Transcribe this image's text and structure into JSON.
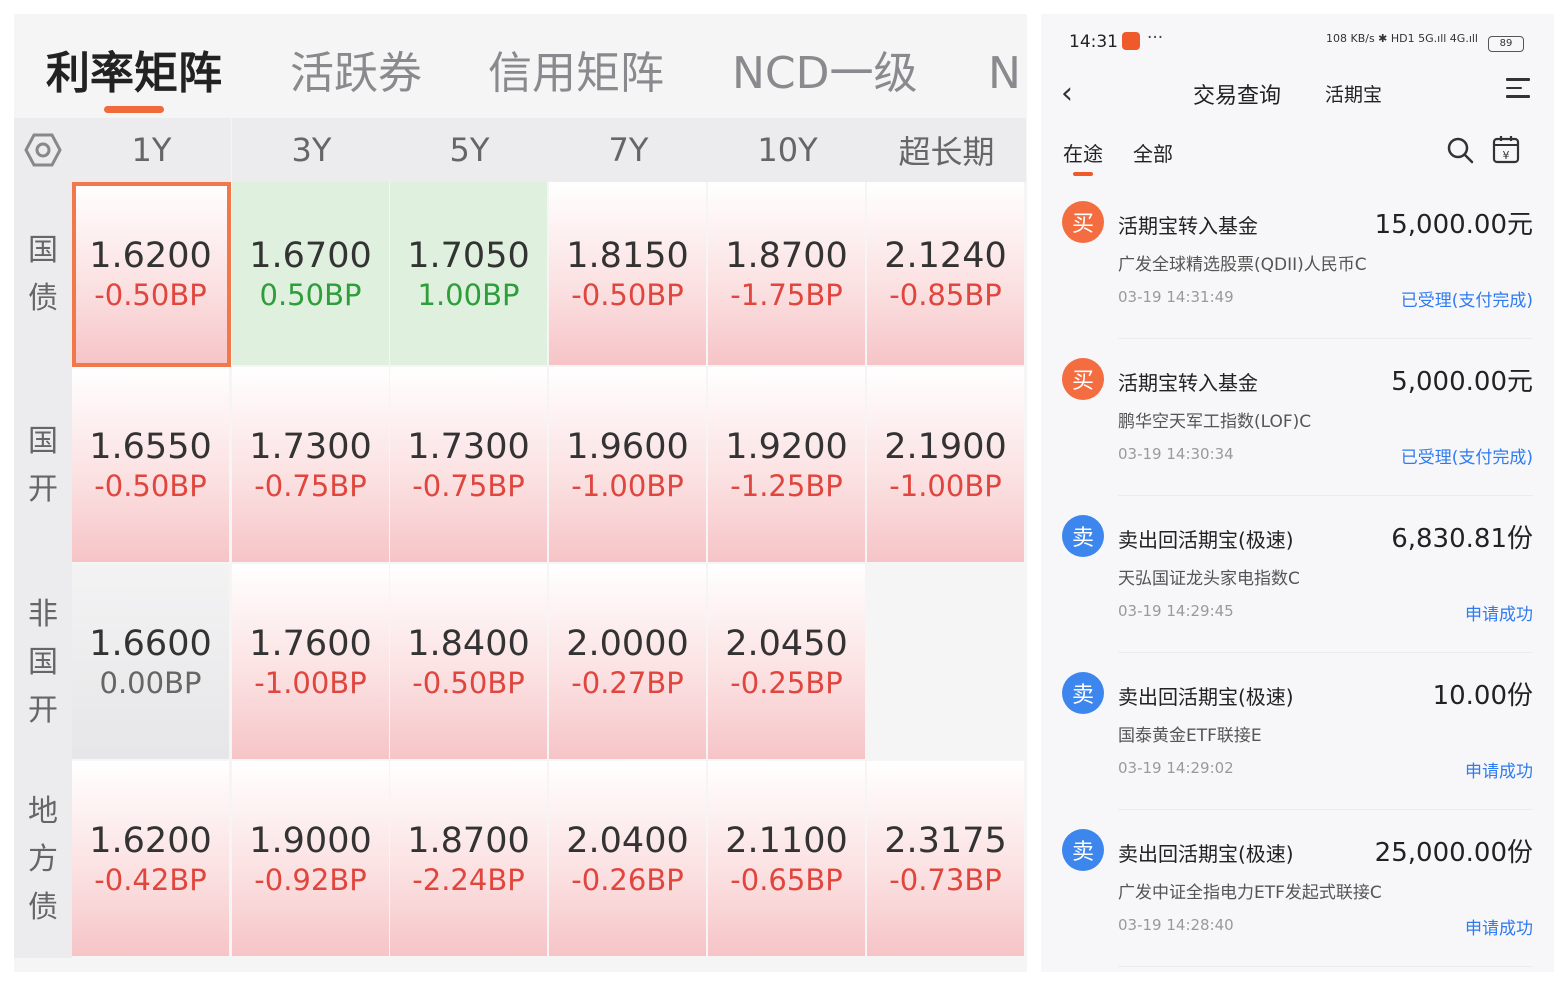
{
  "matrix": {
    "tabs": [
      "利率矩阵",
      "活跃券",
      "信用矩阵",
      "NCD一级",
      "N"
    ],
    "columns": [
      "1Y",
      "3Y",
      "5Y",
      "7Y",
      "10Y",
      "超长期"
    ],
    "rows": [
      {
        "label": [
          "国",
          "债"
        ],
        "cells": [
          {
            "rate": "1.6200",
            "change": "-0.50BP",
            "tone": "red"
          },
          {
            "rate": "1.6700",
            "change": "0.50BP",
            "tone": "green"
          },
          {
            "rate": "1.7050",
            "change": "1.00BP",
            "tone": "green"
          },
          {
            "rate": "1.8150",
            "change": "-0.50BP",
            "tone": "red"
          },
          {
            "rate": "1.8700",
            "change": "-1.75BP",
            "tone": "red"
          },
          {
            "rate": "2.1240",
            "change": "-0.85BP",
            "tone": "red"
          }
        ]
      },
      {
        "label": [
          "国",
          "开"
        ],
        "cells": [
          {
            "rate": "1.6550",
            "change": "-0.50BP",
            "tone": "red"
          },
          {
            "rate": "1.7300",
            "change": "-0.75BP",
            "tone": "red"
          },
          {
            "rate": "1.7300",
            "change": "-0.75BP",
            "tone": "red"
          },
          {
            "rate": "1.9600",
            "change": "-1.00BP",
            "tone": "red"
          },
          {
            "rate": "1.9200",
            "change": "-1.25BP",
            "tone": "red"
          },
          {
            "rate": "2.1900",
            "change": "-1.00BP",
            "tone": "red"
          }
        ]
      },
      {
        "label": [
          "非",
          "国",
          "开"
        ],
        "cells": [
          {
            "rate": "1.6600",
            "change": "0.00BP",
            "tone": "gray"
          },
          {
            "rate": "1.7600",
            "change": "-1.00BP",
            "tone": "red"
          },
          {
            "rate": "1.8400",
            "change": "-0.50BP",
            "tone": "red"
          },
          {
            "rate": "2.0000",
            "change": "-0.27BP",
            "tone": "red"
          },
          {
            "rate": "2.0450",
            "change": "-0.25BP",
            "tone": "red"
          },
          {
            "rate": "",
            "change": "",
            "tone": "empty"
          }
        ]
      },
      {
        "label": [
          "地",
          "方",
          "债"
        ],
        "cells": [
          {
            "rate": "1.6200",
            "change": "-0.42BP",
            "tone": "red"
          },
          {
            "rate": "1.9000",
            "change": "-0.92BP",
            "tone": "red"
          },
          {
            "rate": "1.8700",
            "change": "-2.24BP",
            "tone": "red"
          },
          {
            "rate": "2.0400",
            "change": "-0.26BP",
            "tone": "red"
          },
          {
            "rate": "2.1100",
            "change": "-0.65BP",
            "tone": "red"
          },
          {
            "rate": "2.3175",
            "change": "-0.73BP",
            "tone": "red"
          }
        ]
      }
    ],
    "colors": {
      "up": "#2e9e3b",
      "down": "#e0463e",
      "accent": "#f26a3c"
    }
  },
  "phone": {
    "status": {
      "time": "14:31",
      "dots": "···",
      "signal": "108 KB/s ✱ HD1 5G.ıll 4G.ıll",
      "battery": "89"
    },
    "nav": {
      "back": "‹",
      "title": "交易查询",
      "subtitle": "活期宝"
    },
    "filters": [
      "在途",
      "全部"
    ],
    "transactions": [
      {
        "type": "买",
        "kind": "buy",
        "title": "活期宝转入基金",
        "amount": "15,000.00元",
        "fund": "广发全球精选股票(QDII)人民币C",
        "time": "03-19 14:31:49",
        "status": "已受理(支付完成)"
      },
      {
        "type": "买",
        "kind": "buy",
        "title": "活期宝转入基金",
        "amount": "5,000.00元",
        "fund": "鹏华空天军工指数(LOF)C",
        "time": "03-19 14:30:34",
        "status": "已受理(支付完成)"
      },
      {
        "type": "卖",
        "kind": "sell",
        "title": "卖出回活期宝(极速)",
        "amount": "6,830.81份",
        "fund": "天弘国证龙头家电指数C",
        "time": "03-19 14:29:45",
        "status": "申请成功"
      },
      {
        "type": "卖",
        "kind": "sell",
        "title": "卖出回活期宝(极速)",
        "amount": "10.00份",
        "fund": "国泰黄金ETF联接E",
        "time": "03-19 14:29:02",
        "status": "申请成功"
      },
      {
        "type": "卖",
        "kind": "sell",
        "title": "卖出回活期宝(极速)",
        "amount": "25,000.00份",
        "fund": "广发中证全指电力ETF发起式联接C",
        "time": "03-19 14:28:40",
        "status": "申请成功"
      }
    ]
  }
}
